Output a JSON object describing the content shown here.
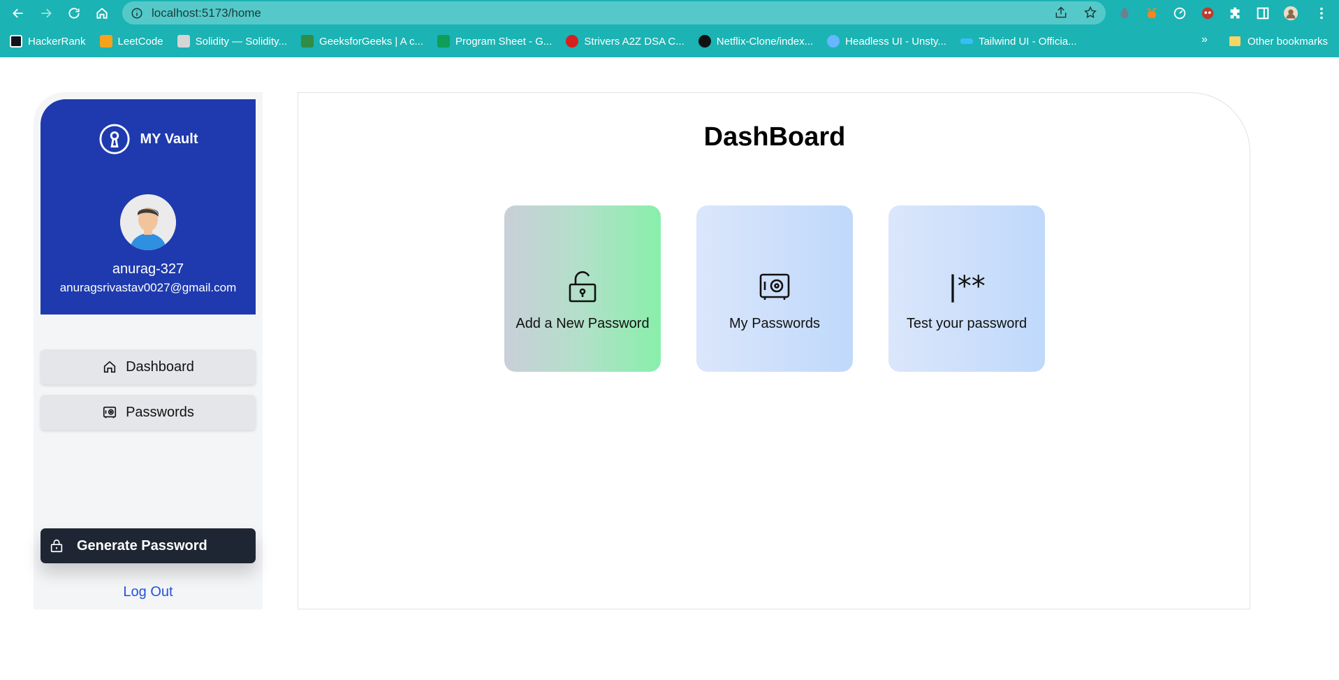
{
  "browser": {
    "url": "localhost:5173/home",
    "bookmarks": [
      {
        "label": "HackerRank",
        "color": "#0e141e"
      },
      {
        "label": "LeetCode",
        "color": "#f7a21b"
      },
      {
        "label": "Solidity — Solidity...",
        "color": "#444444"
      },
      {
        "label": "GeeksforGeeks | A c...",
        "color": "#2f8d46"
      },
      {
        "label": "Program Sheet - G...",
        "color": "#0f9d58"
      },
      {
        "label": "Strivers A2Z DSA C...",
        "color": "#d61f1f"
      },
      {
        "label": "Netflix-Clone/index...",
        "color": "#111111"
      },
      {
        "label": "Headless UI - Unsty...",
        "color": "#66b7ff"
      },
      {
        "label": "Tailwind UI - Officia...",
        "color": "#38bdf8"
      }
    ],
    "more_label": "»",
    "other_bookmarks": "Other bookmarks"
  },
  "sidebar": {
    "brand": "MY Vault",
    "username": "anurag-327",
    "email": "anuragsrivastav0027@gmail.com",
    "menu": [
      {
        "label": "Dashboard",
        "icon": "home-icon"
      },
      {
        "label": "Passwords",
        "icon": "vault-icon"
      }
    ],
    "generate_label": "Generate Password",
    "logout_label": "Log Out"
  },
  "main": {
    "title": "DashBoard",
    "cards": [
      {
        "label": "Add a New Password",
        "icon": "unlock-icon"
      },
      {
        "label": "My Passwords",
        "icon": "vault-icon"
      },
      {
        "label": "Test your password",
        "icon": "password-cursor-icon",
        "icon_text": "|**"
      }
    ]
  },
  "colors": {
    "chrome": "#1bb3b3",
    "profile_card": "#1e3aae",
    "generate_button": "#1f2633",
    "logout_link": "#2552d6"
  }
}
